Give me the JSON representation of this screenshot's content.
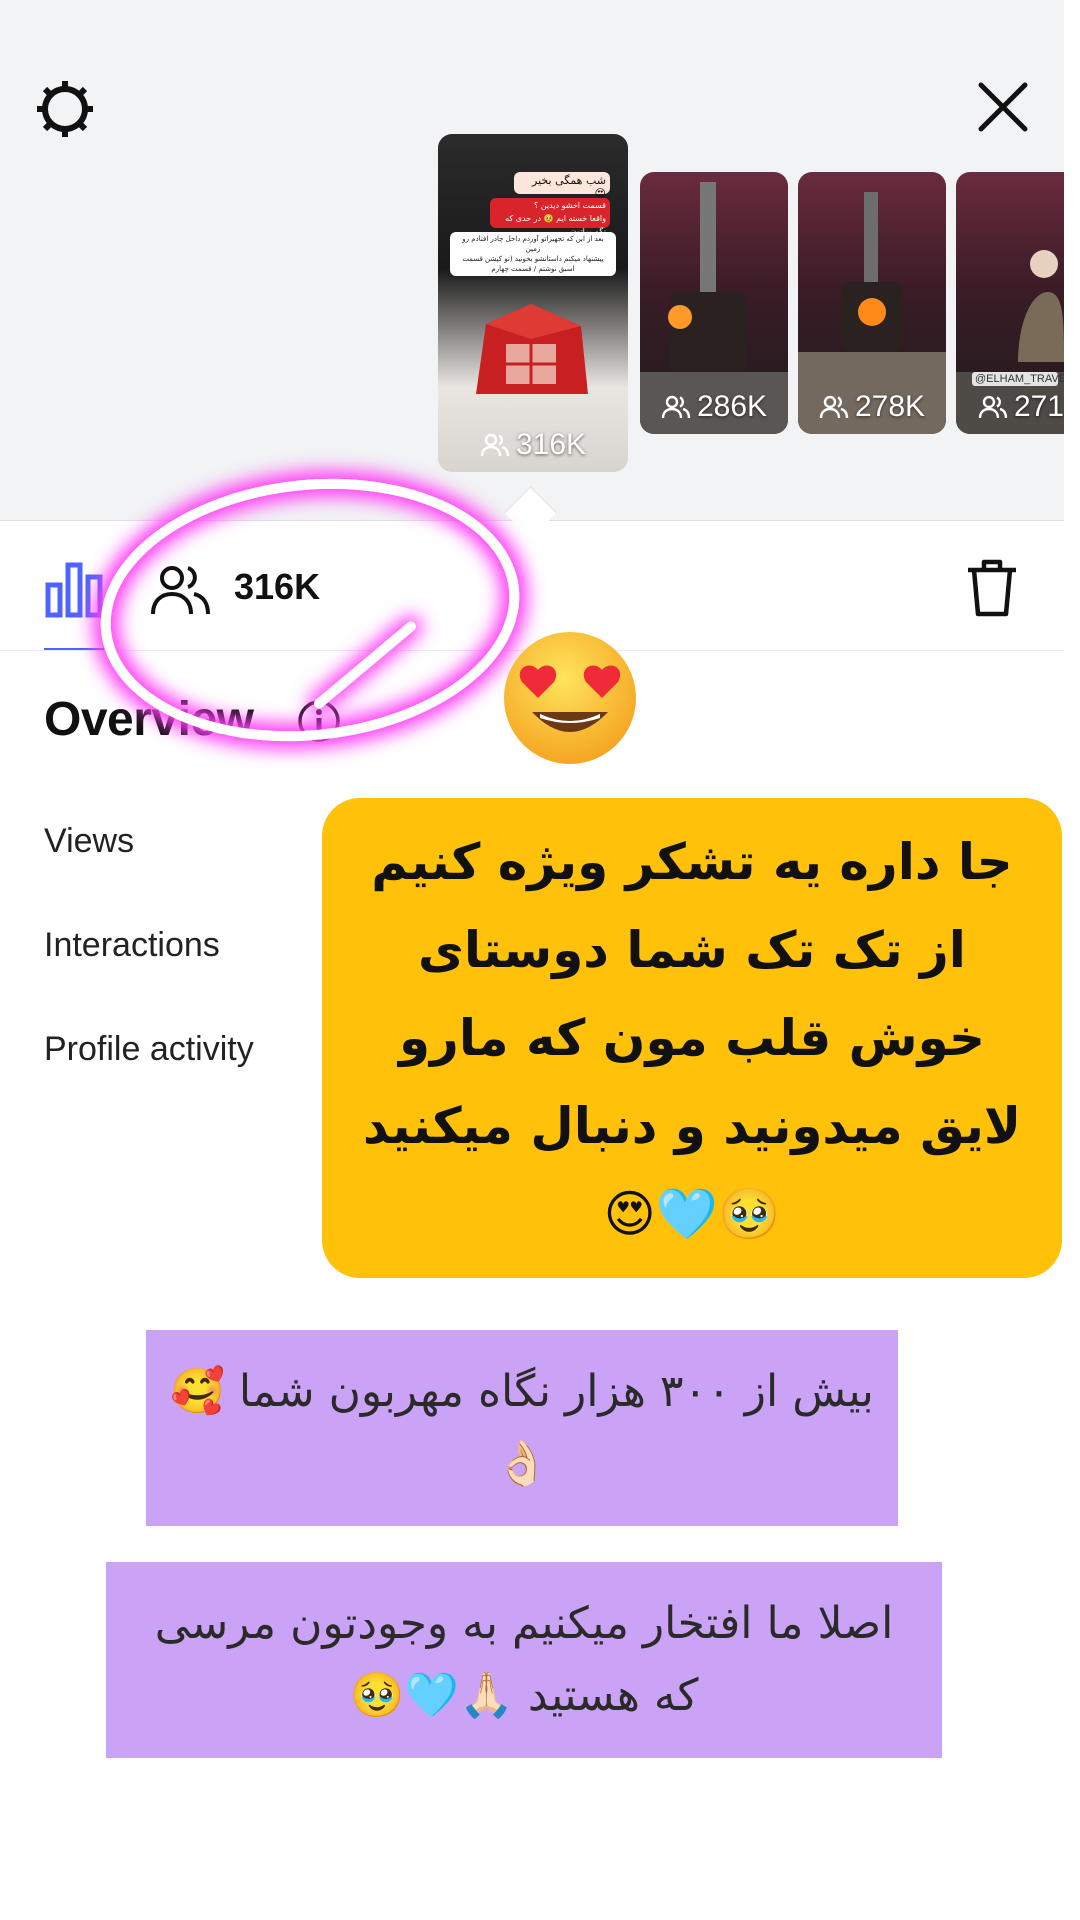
{
  "header": {
    "settings_icon": "gear-icon",
    "close_icon": "close-icon"
  },
  "stories": [
    {
      "count": "316K",
      "selected": true,
      "text_lines": [
        "شب همگی بخیر 😍",
        "قسمت اخشو دیدین ؟",
        "واقعا خسته ایم 🥹 در حدی که نگم براتون ..",
        "بعد از این که تجهیزاتو آوردم داخل چادر افتادم رو زمین",
        "پیشنهاد میکنم داستانشو بخونید (تو کپشن قسمت",
        "اسبق نوشتم / قسمت چهارم"
      ]
    },
    {
      "count": "286K",
      "selected": false
    },
    {
      "count": "278K",
      "selected": false
    },
    {
      "count": "271",
      "selected": false,
      "handle": "@ELHAM_TRAVELL"
    }
  ],
  "insights": {
    "chart_tab_icon": "bar-chart-icon",
    "reach_icon": "people-icon",
    "reach_count": "316K",
    "delete_icon": "trash-icon",
    "overview_title": "Overview",
    "info_icon": "info-icon",
    "metrics": [
      "Views",
      "Interactions",
      "Profile activity"
    ]
  },
  "overlay": {
    "yellow_text": "جا داره یه تشکر ویژه کنیم از تک تک شما دوستای خوش قلب مون که مارو لایق میدونید و دنبال میکنید 🥹🩵😍",
    "purple_text_1": "بیش از ۳۰۰ هزار نگاه مهربون شما 🥰👌🏻",
    "purple_text_2": "اصلا ما افتخار میکنیم به وجودتون مرسی که هستید 🙏🏻🩵🥹"
  },
  "colors": {
    "accent": "#4f63ff",
    "yellow": "#ffc10a",
    "purple": "#cba3f6",
    "neon": "#ff3cf5"
  }
}
